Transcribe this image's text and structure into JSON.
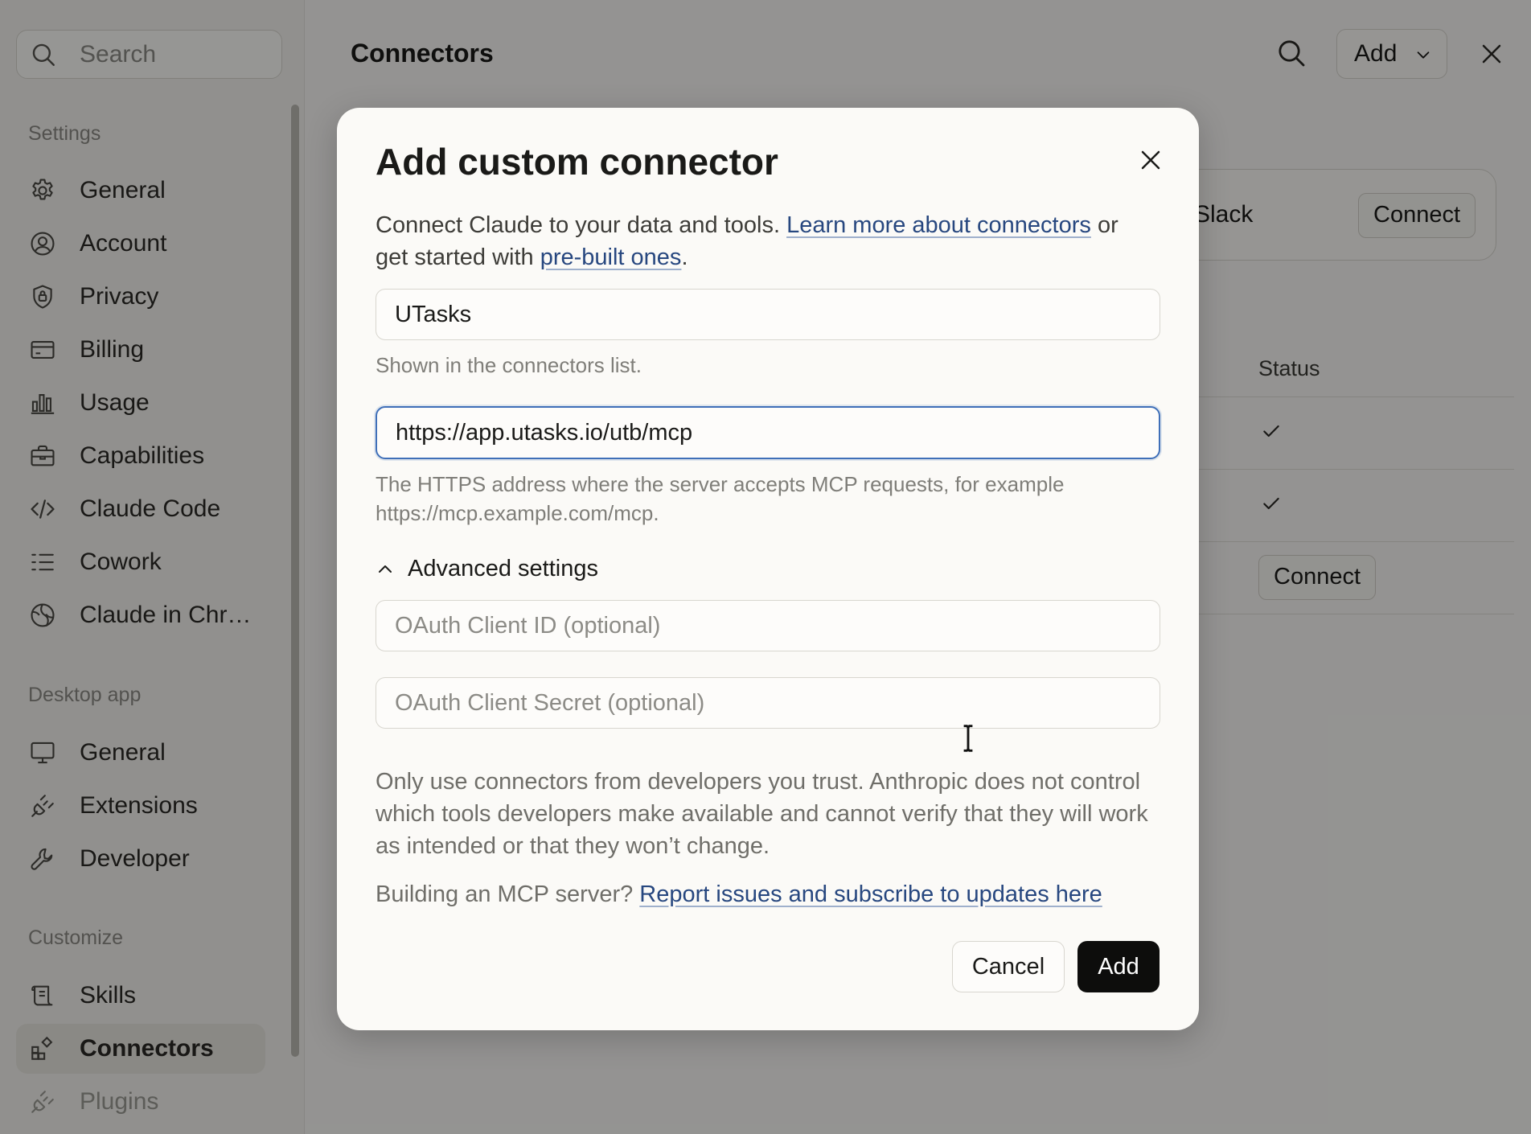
{
  "sidebar": {
    "search_placeholder": "Search",
    "sections": [
      {
        "label": "Settings",
        "items": [
          {
            "label": "General",
            "icon": "gear-icon"
          },
          {
            "label": "Account",
            "icon": "user-circle-icon"
          },
          {
            "label": "Privacy",
            "icon": "shield-icon"
          },
          {
            "label": "Billing",
            "icon": "credit-card-icon"
          },
          {
            "label": "Usage",
            "icon": "bar-chart-icon"
          },
          {
            "label": "Capabilities",
            "icon": "briefcase-icon"
          },
          {
            "label": "Claude Code",
            "icon": "code-icon"
          },
          {
            "label": "Cowork",
            "icon": "list-icon"
          },
          {
            "label": "Claude in Chr…",
            "icon": "globe-icon"
          }
        ]
      },
      {
        "label": "Desktop app",
        "items": [
          {
            "label": "General",
            "icon": "monitor-icon"
          },
          {
            "label": "Extensions",
            "icon": "plug-icon"
          },
          {
            "label": "Developer",
            "icon": "wrench-icon"
          }
        ]
      },
      {
        "label": "Customize",
        "items": [
          {
            "label": "Skills",
            "icon": "scroll-icon"
          },
          {
            "label": "Connectors",
            "icon": "grid-plus-icon",
            "active": true
          },
          {
            "label": "Plugins",
            "icon": "plug-icon"
          }
        ]
      }
    ]
  },
  "main": {
    "title": "Connectors",
    "add_label": "Add",
    "slack_name": "Slack",
    "connect_label": "Connect",
    "status_header": "Status",
    "row_connect_label": "Connect"
  },
  "modal": {
    "title": "Add custom connector",
    "desc_prefix": "Connect Claude to your data and tools. ",
    "desc_link1": "Learn more about connectors",
    "desc_mid": " or get started with ",
    "desc_link2": "pre-built ones",
    "desc_suffix": ".",
    "name_value": "UTasks",
    "name_hint": "Shown in the connectors list.",
    "url_value": "https://app.utasks.io/utb/mcp",
    "url_hint": "The HTTPS address where the server accepts MCP requests, for example https://mcp.example.com/mcp.",
    "advanced_label": "Advanced settings",
    "client_id_placeholder": "OAuth Client ID (optional)",
    "client_secret_placeholder": "OAuth Client Secret (optional)",
    "warning": "Only use connectors from developers you trust. Anthropic does not control which tools developers make available and cannot verify that they will work as intended or that they won’t change.",
    "mcp_prefix": "Building an MCP server? ",
    "mcp_link": "Report issues and subscribe to updates here",
    "cancel_label": "Cancel",
    "submit_label": "Add"
  }
}
